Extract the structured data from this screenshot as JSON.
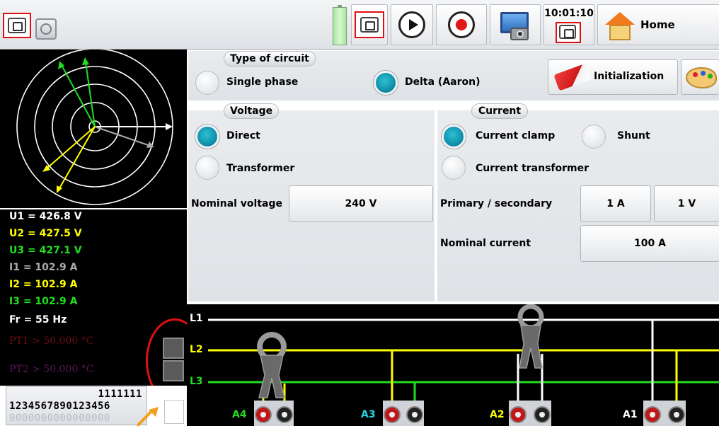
{
  "toolbar": {
    "time": "10:01:10",
    "home_label": "Home"
  },
  "measurements": [
    {
      "text": "U1 = 426.8 V",
      "color": "#ffffff"
    },
    {
      "text": "U2 = 427.5 V",
      "color": "#ffff00"
    },
    {
      "text": "U3 = 427.1 V",
      "color": "#22dd22"
    },
    {
      "text": "I1 = 102.9 A",
      "color": "#a9a9a9"
    },
    {
      "text": "I2 = 102.9 A",
      "color": "#ffff00"
    },
    {
      "text": "I3 = 102.9 A",
      "color": "#22dd22"
    },
    {
      "text": "Fr = 55 Hz",
      "color": "#ffffff"
    },
    {
      "text": "PT1 > 50.000 °C",
      "color": "#6b0d0d"
    },
    {
      "text": "PT2 > 50.000 °C",
      "color": "#5a145a"
    }
  ],
  "channel_strip": {
    "row1": "1111111",
    "row2": "1234567890123456",
    "row3": "0000000000000000"
  },
  "circuit": {
    "legend": "Type of circuit",
    "options": [
      {
        "label": "Single phase",
        "selected": false
      },
      {
        "label": "Delta (Aaron)",
        "selected": true
      }
    ],
    "init_button": "Initialization"
  },
  "voltage": {
    "legend": "Voltage",
    "options": [
      {
        "label": "Direct",
        "selected": true
      },
      {
        "label": "Transformer",
        "selected": false
      }
    ],
    "nominal_label": "Nominal voltage",
    "nominal_value": "240 V"
  },
  "current": {
    "legend": "Current",
    "options": [
      {
        "label": "Current clamp",
        "selected": true
      },
      {
        "label": "Shunt",
        "selected": false
      },
      {
        "label": "Current transformer",
        "selected": false
      }
    ],
    "ratio_label": "Primary / secondary",
    "primary": "1 A",
    "secondary": "1 V",
    "nominal_label": "Nominal current",
    "nominal_value": "100 A"
  },
  "wiring": {
    "lines": [
      "L1",
      "L2",
      "L3"
    ],
    "inputs": [
      {
        "label": "A4",
        "color": "#22dd22"
      },
      {
        "label": "A3",
        "color": "#22d6e6"
      },
      {
        "label": "A2",
        "color": "#ffff00"
      },
      {
        "label": "A1",
        "color": "#ffffff"
      }
    ]
  }
}
